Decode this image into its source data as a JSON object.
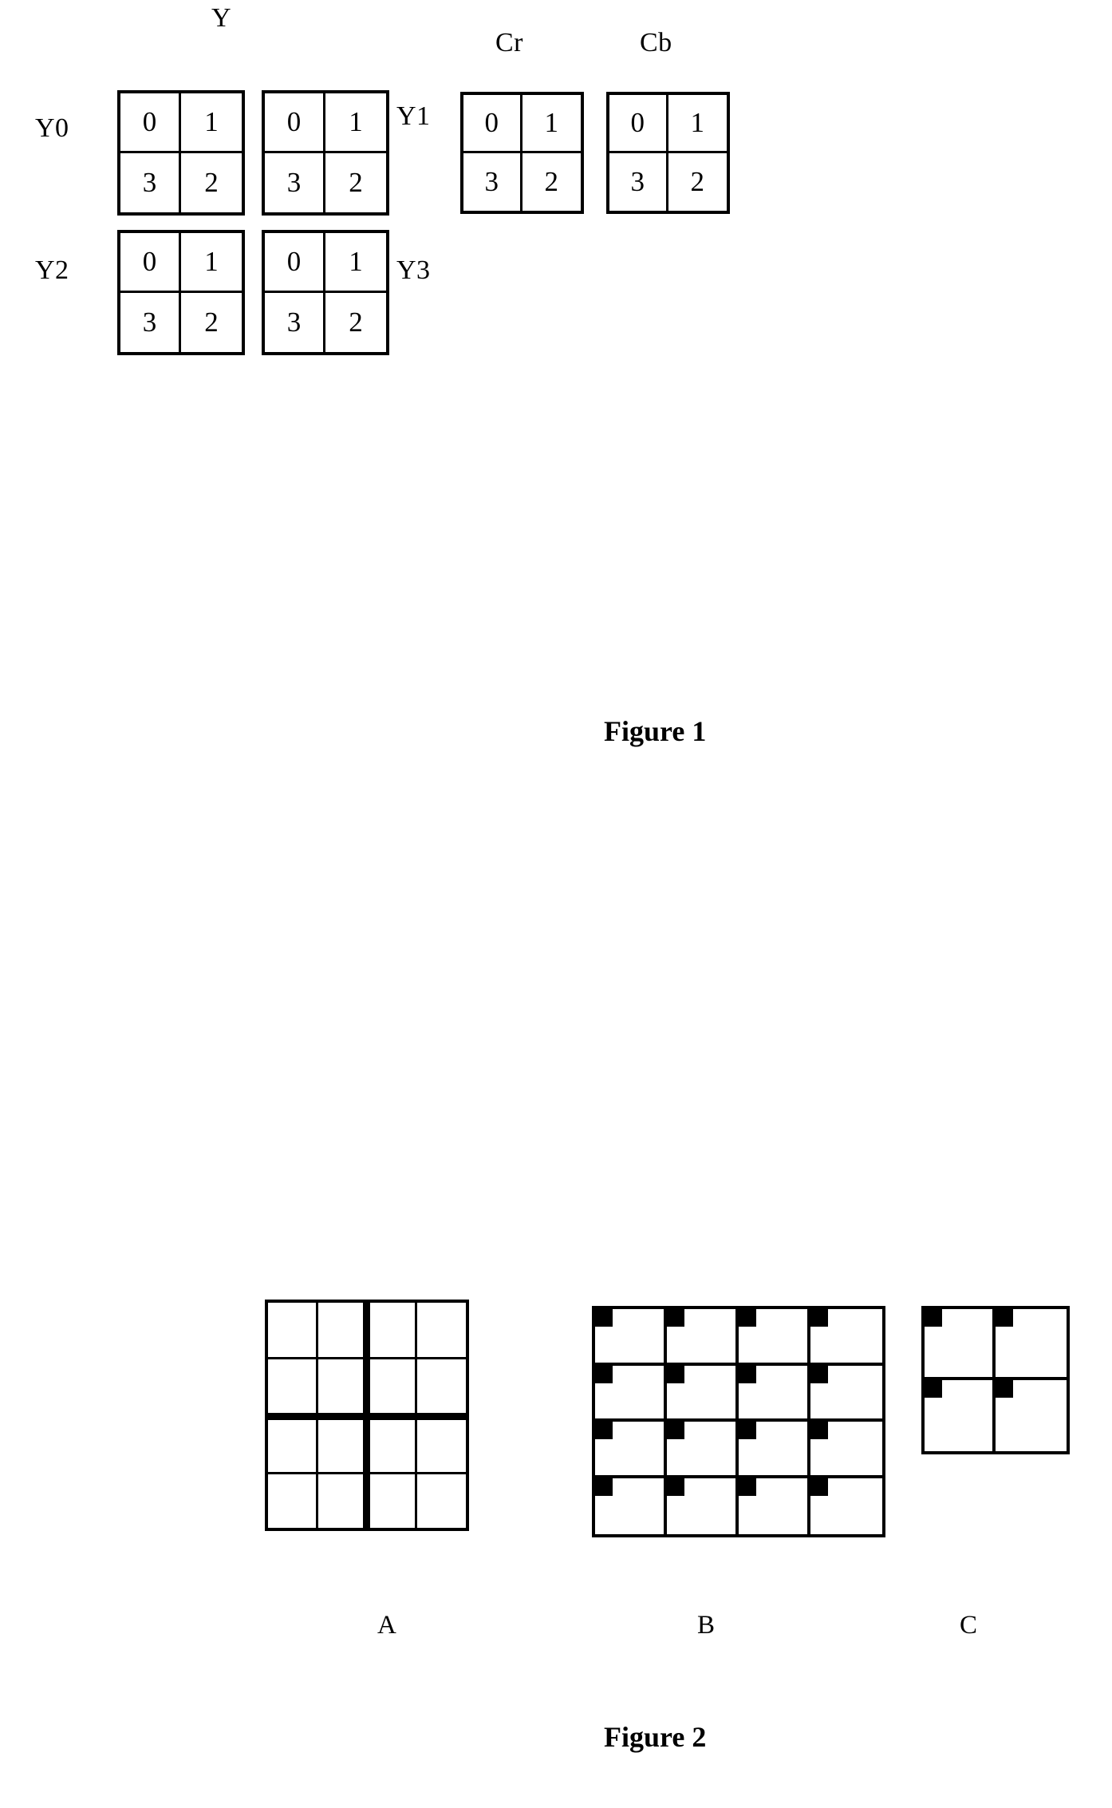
{
  "document": {
    "type": "patent-figure-sheet",
    "background_color": "#ffffff",
    "ink_color": "#000000"
  },
  "figure1": {
    "caption": "Figure 1",
    "plane_headers": [
      {
        "name": "Y",
        "label": "Y"
      },
      {
        "name": "Cr",
        "label": "Cr"
      },
      {
        "name": "Cb",
        "label": "Cb"
      }
    ],
    "block_labels": {
      "y0": "Y0",
      "y1": "Y1",
      "y2": "Y2",
      "y3": "Y3"
    },
    "block_values": [
      "0",
      "1",
      "3",
      "2"
    ],
    "blocks": [
      {
        "id": "y-block-0",
        "label": "Y0",
        "plane": "Y",
        "values": [
          "0",
          "1",
          "3",
          "2"
        ]
      },
      {
        "id": "y-block-1",
        "label": "Y1",
        "plane": "Y",
        "values": [
          "0",
          "1",
          "3",
          "2"
        ]
      },
      {
        "id": "y-block-2",
        "label": "Y2",
        "plane": "Y",
        "values": [
          "0",
          "1",
          "3",
          "2"
        ]
      },
      {
        "id": "y-block-3",
        "label": "Y3",
        "plane": "Y",
        "values": [
          "0",
          "1",
          "3",
          "2"
        ]
      },
      {
        "id": "cr-block",
        "label": "Cr",
        "plane": "Cr",
        "values": [
          "0",
          "1",
          "3",
          "2"
        ]
      },
      {
        "id": "cb-block",
        "label": "Cb",
        "plane": "Cb",
        "values": [
          "0",
          "1",
          "3",
          "2"
        ]
      }
    ]
  },
  "figure2": {
    "caption": "Figure 2",
    "panels": [
      {
        "id": "panel-a",
        "label": "A",
        "rows": 4,
        "cols": 4,
        "corner_marks": false,
        "quadrant_divider": true
      },
      {
        "id": "panel-b",
        "label": "B",
        "rows": 4,
        "cols": 4,
        "corner_marks": true,
        "quadrant_divider": false
      },
      {
        "id": "panel-c",
        "label": "C",
        "rows": 2,
        "cols": 2,
        "corner_marks": true,
        "quadrant_divider": false
      }
    ]
  }
}
